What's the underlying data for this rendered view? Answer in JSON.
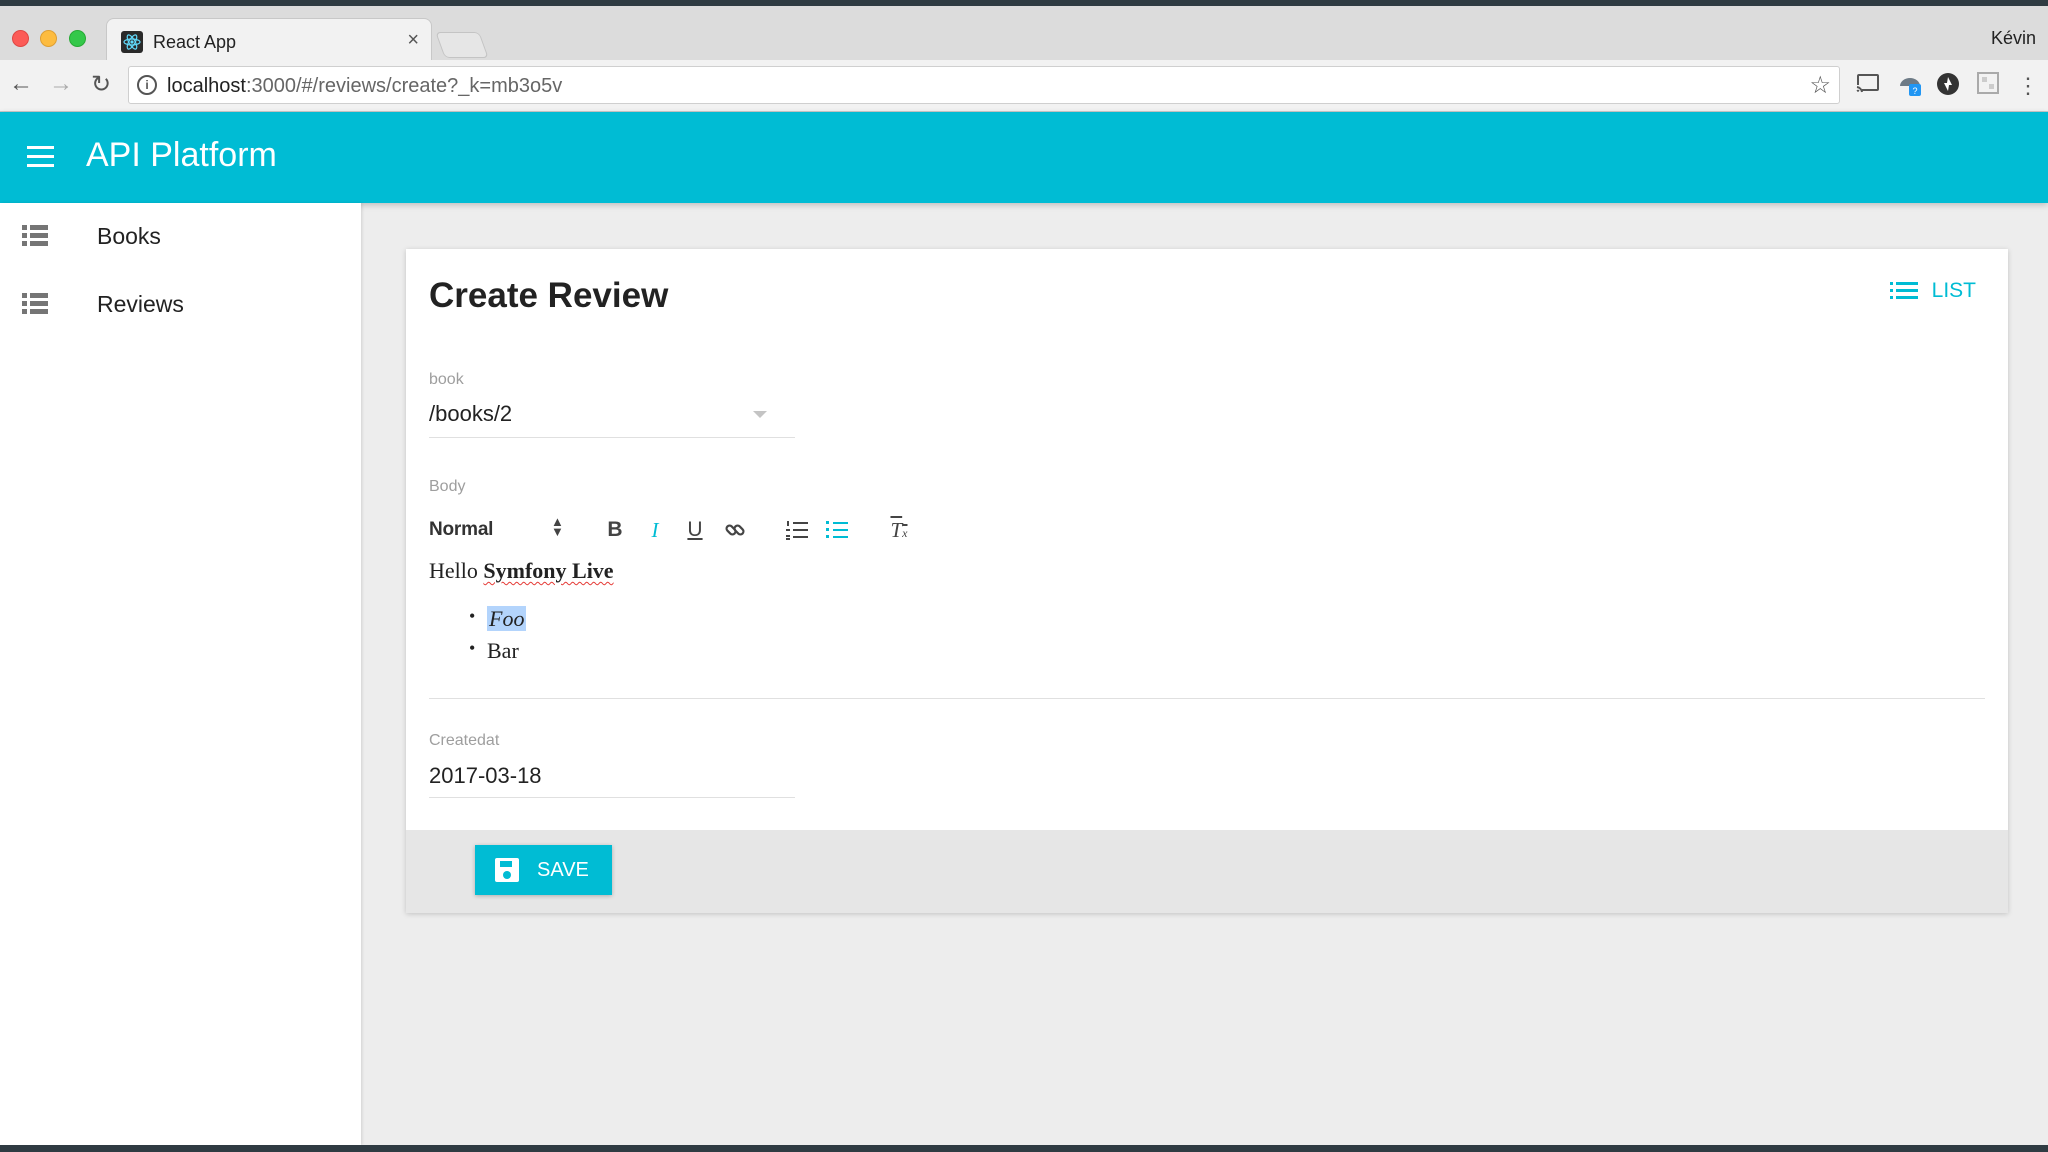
{
  "browser": {
    "tab_title": "React App",
    "tab_close": "×",
    "profile_name": "Kévin",
    "url_host": "localhost",
    "url_path": ":3000/#/reviews/create?_k=mb3o5v"
  },
  "app": {
    "title": "API Platform",
    "accent_color": "#00bcd4"
  },
  "sidebar": {
    "items": [
      {
        "label": "Books",
        "icon": "list-view-icon"
      },
      {
        "label": "Reviews",
        "icon": "list-view-icon"
      }
    ]
  },
  "form": {
    "title": "Create Review",
    "list_button": "LIST",
    "book": {
      "label": "book",
      "value": "/books/2"
    },
    "body": {
      "label": "Body",
      "format_select": "Normal",
      "content": {
        "line_hello": "Hello",
        "line_bold": "Symfony Live",
        "bullets": [
          "Foo",
          "Bar"
        ]
      }
    },
    "createdat": {
      "label": "Createdat",
      "value": "2017-03-18"
    },
    "save_button": "SAVE"
  }
}
